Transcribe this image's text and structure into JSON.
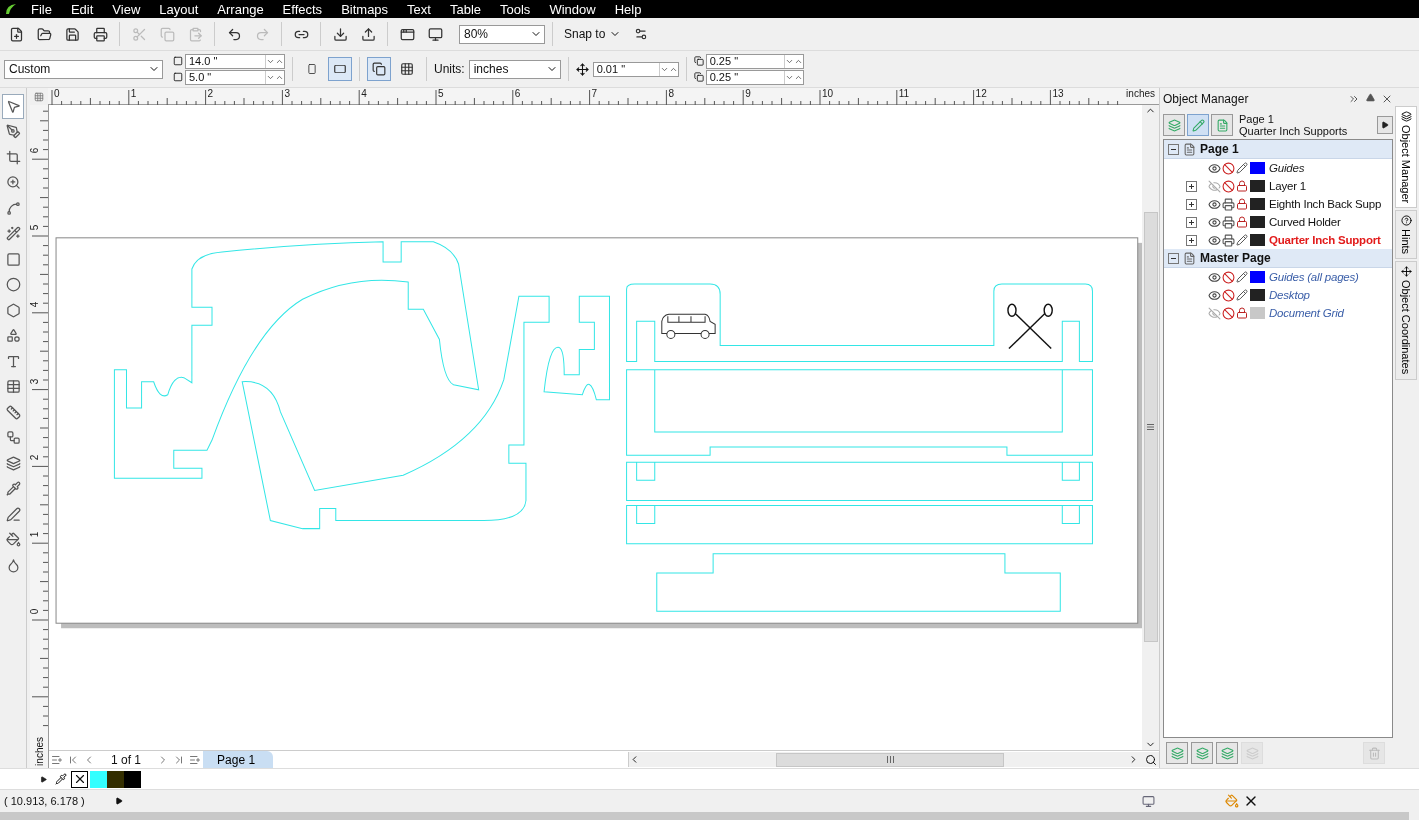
{
  "menu": [
    "File",
    "Edit",
    "View",
    "Layout",
    "Arrange",
    "Effects",
    "Bitmaps",
    "Text",
    "Table",
    "Tools",
    "Window",
    "Help"
  ],
  "toolbar": {
    "buttons": [
      {
        "kind": "new",
        "disabled": false
      },
      {
        "kind": "open",
        "disabled": false
      },
      {
        "kind": "save",
        "disabled": false
      },
      {
        "kind": "print",
        "disabled": false
      },
      {
        "kind": "separator"
      },
      {
        "kind": "cut",
        "disabled": true
      },
      {
        "kind": "copy",
        "disabled": true
      },
      {
        "kind": "paste",
        "disabled": true
      },
      {
        "kind": "separator"
      },
      {
        "kind": "undo",
        "disabled": false
      },
      {
        "kind": "redo",
        "disabled": true
      },
      {
        "kind": "separator"
      },
      {
        "kind": "connect",
        "disabled": false
      },
      {
        "kind": "separator"
      },
      {
        "kind": "import",
        "disabled": false
      },
      {
        "kind": "export",
        "disabled": false
      },
      {
        "kind": "separator"
      },
      {
        "kind": "launcher",
        "disabled": false
      },
      {
        "kind": "welcome",
        "disabled": false
      }
    ],
    "zoom": "80%",
    "snap": "Snap to"
  },
  "property_bar": {
    "page_size": "Custom",
    "width": "14.0 \"",
    "height": "5.0 \"",
    "orientation": [
      {
        "kind": "portrait",
        "selected": false
      },
      {
        "kind": "landscape",
        "selected": true
      }
    ],
    "page_scope": [
      {
        "kind": "all-pages",
        "selected": true
      },
      {
        "kind": "current-page",
        "selected": false
      }
    ],
    "units_label": "Units:",
    "units": "inches",
    "nudge": "0.01 \"",
    "duplicate_x": "0.25 \"",
    "duplicate_y": "0.25 \""
  },
  "tools": [
    {
      "kind": "pick",
      "selected": true
    },
    {
      "kind": "shape",
      "selected": false
    },
    {
      "kind": "crop",
      "selected": false
    },
    {
      "kind": "zoom",
      "selected": false
    },
    {
      "kind": "curve",
      "selected": false
    },
    {
      "kind": "smart",
      "selected": false
    },
    {
      "kind": "rectangle",
      "selected": false
    },
    {
      "kind": "ellipse",
      "selected": false
    },
    {
      "kind": "polygon",
      "selected": false
    },
    {
      "kind": "shapes",
      "selected": false
    },
    {
      "kind": "text",
      "selected": false
    },
    {
      "kind": "table",
      "selected": false
    },
    {
      "kind": "dimension",
      "selected": false
    },
    {
      "kind": "connector",
      "selected": false
    },
    {
      "kind": "blend",
      "selected": false
    },
    {
      "kind": "eyedropper",
      "selected": false
    },
    {
      "kind": "outline",
      "selected": false
    },
    {
      "kind": "fill",
      "selected": false
    },
    {
      "kind": "interactive-fill",
      "selected": false
    }
  ],
  "rulers": {
    "unit_top": "inches",
    "x_labels": [
      "0",
      "1",
      "2",
      "3",
      "4",
      "5",
      "6",
      "7",
      "8",
      "9",
      "10",
      "11",
      "12",
      "13"
    ],
    "y_labels": [
      "0",
      "1",
      "2",
      "3",
      "4",
      "5",
      "6"
    ],
    "unit_side": "inches"
  },
  "page_nav": {
    "counter": "1 of 1",
    "tabs": [
      {
        "label": "Page 1",
        "selected": true
      }
    ]
  },
  "palette": [
    {
      "kind": "none"
    },
    {
      "kind": "swatch",
      "color": "#33ffff"
    },
    {
      "kind": "swatch",
      "color": "#332e00"
    },
    {
      "kind": "swatch",
      "color": "#000000"
    }
  ],
  "status": {
    "coords": "( 10.913, 6.178 )"
  },
  "object_manager": {
    "title": "Object Manager",
    "current_page": "Page 1",
    "current_layer": "Quarter Inch Supports",
    "tree": [
      {
        "label": "Page 1",
        "expanded": true,
        "children": [
          {
            "label": "Guides",
            "kind": "guide",
            "visible": true,
            "printable": false,
            "editable": true,
            "color": "#0000ff",
            "active": false
          },
          {
            "label": "Layer 1",
            "kind": "layer",
            "expanded": false,
            "visible": false,
            "printable": false,
            "editable": false,
            "color": "#222222",
            "active": false
          },
          {
            "label": "Eighth Inch Back Supp",
            "kind": "layer",
            "expanded": false,
            "visible": true,
            "printable": true,
            "editable": false,
            "color": "#222222",
            "active": false
          },
          {
            "label": "Curved Holder",
            "kind": "layer",
            "expanded": false,
            "visible": true,
            "printable": true,
            "editable": false,
            "color": "#222222",
            "active": false
          },
          {
            "label": "Quarter Inch Support",
            "kind": "layer",
            "expanded": false,
            "visible": true,
            "printable": true,
            "editable": true,
            "color": "#222222",
            "active": true
          }
        ]
      },
      {
        "label": "Master Page",
        "expanded": true,
        "children": [
          {
            "label": "Guides (all pages)",
            "kind": "master",
            "visible": true,
            "printable": false,
            "editable": true,
            "color": "#0000ff",
            "active": false
          },
          {
            "label": "Desktop",
            "kind": "master",
            "visible": true,
            "printable": false,
            "editable": true,
            "color": "#222222",
            "active": false
          },
          {
            "label": "Document Grid",
            "kind": "master",
            "visible": false,
            "printable": false,
            "editable": false,
            "color": "#c8c8c8",
            "active": false
          }
        ]
      }
    ]
  },
  "side_tabs": [
    {
      "label": "Object Manager",
      "kind": "manager",
      "selected": true
    },
    {
      "label": "Hints",
      "kind": "hints",
      "selected": false
    },
    {
      "label": "Object Coordinates",
      "kind": "coords",
      "selected": false
    }
  ]
}
